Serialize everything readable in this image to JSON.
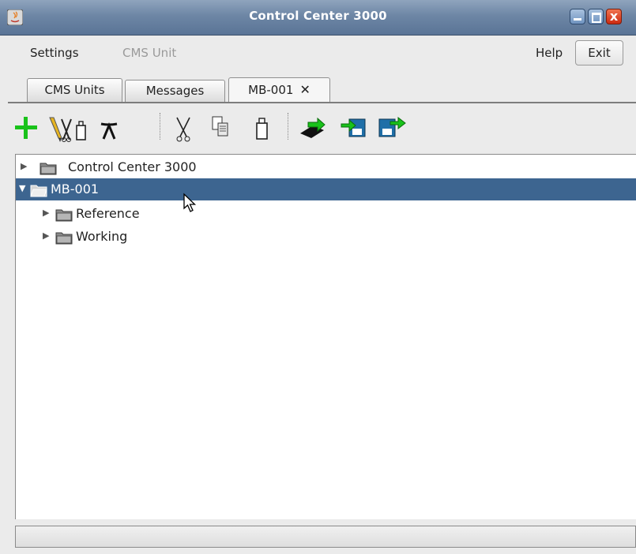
{
  "window": {
    "title": "Control Center 3000"
  },
  "menu": {
    "settings": "Settings",
    "cms_unit": "CMS Unit",
    "help": "Help",
    "exit": "Exit"
  },
  "tabs": [
    {
      "label": "CMS Units"
    },
    {
      "label": "Messages"
    },
    {
      "label": "MB-001",
      "close": "✕"
    }
  ],
  "toolbar": {
    "icons": [
      "add-icon",
      "edit-icon",
      "delete-icon",
      "cut-icon",
      "copy-icon",
      "paste-icon",
      "send-icon",
      "import-icon",
      "export-icon"
    ]
  },
  "tree": {
    "root": {
      "label": "Control Center 3000",
      "expanded": false
    },
    "selected": {
      "label": "MB-001",
      "expanded": true
    },
    "children": [
      {
        "label": "Reference",
        "expanded": false
      },
      {
        "label": "Working",
        "expanded": false
      }
    ]
  },
  "colors": {
    "selection": "#3d6590",
    "titlebar": "#6d86a5",
    "accent_green": "#19c21a"
  }
}
